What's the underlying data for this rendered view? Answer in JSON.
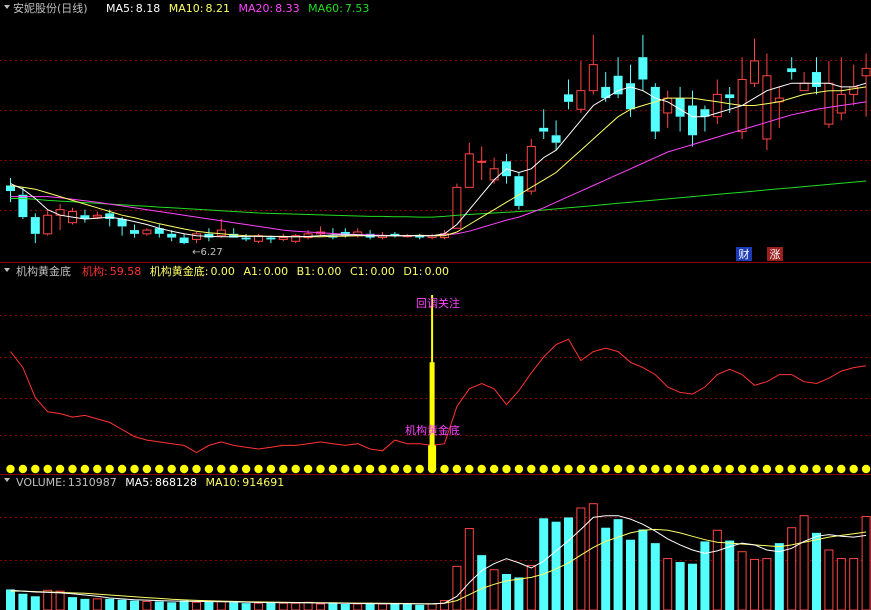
{
  "colors": {
    "bg": "#000000",
    "grid": "#8a0000",
    "up": "#ff4444",
    "down": "#54ffff",
    "ma5": "#ffffff",
    "ma10": "#ffff66",
    "ma20": "#ff44ff",
    "ma60": "#22dd22",
    "label": "#c0c0c0",
    "jigou_line": "#ff3333",
    "signal": "#ffff00",
    "annotation": "#ff44ff"
  },
  "price_panel": {
    "title": "安妮股份(日线)",
    "legend": [
      {
        "label": "MA5:",
        "value": "8.18",
        "color": "#ffffff"
      },
      {
        "label": "MA10:",
        "value": "8.21",
        "color": "#ffff66"
      },
      {
        "label": "MA20:",
        "value": "8.33",
        "color": "#ff44ff"
      },
      {
        "label": "MA60:",
        "value": "7.53",
        "color": "#22dd22"
      }
    ],
    "low_annotation": "←6.27",
    "badges": [
      {
        "text": "财",
        "bg": "#1d3bb5",
        "fg": "#ffffff"
      },
      {
        "text": "涨",
        "bg": "#9a1f1f",
        "fg": "#ffffff"
      }
    ]
  },
  "indicator_panel": {
    "title": "机构黄金底",
    "legend": [
      {
        "label": "机构:",
        "value": "59.58",
        "color": "#ff3333"
      },
      {
        "label": "机构黄金底:",
        "value": "0.00",
        "color": "#ffff66"
      },
      {
        "label": "A1:",
        "value": "0.00",
        "color": "#ffff66"
      },
      {
        "label": "B1:",
        "value": "0.00",
        "color": "#ffff66"
      },
      {
        "label": "C1:",
        "value": "0.00",
        "color": "#ffff66"
      },
      {
        "label": "D1:",
        "value": "0.00",
        "color": "#ffff66"
      }
    ],
    "annotation_top": "回调关注",
    "annotation_bottom": "机构黄金底"
  },
  "volume_panel": {
    "legend": [
      {
        "label": "VOLUME:",
        "value": "1310987",
        "color": "#c0c0c0"
      },
      {
        "label": "MA5:",
        "value": "868128",
        "color": "#ffffff"
      },
      {
        "label": "MA10:",
        "value": "914691",
        "color": "#ffff66"
      }
    ]
  },
  "chart_data": [
    {
      "type": "candlestick",
      "name": "price",
      "ylim": [
        5.9,
        12.3
      ],
      "candles": [
        [
          7.85,
          7.7,
          8.05,
          7.4
        ],
        [
          7.6,
          7.0,
          7.8,
          6.95
        ],
        [
          7.0,
          6.55,
          7.1,
          6.3
        ],
        [
          6.55,
          7.05,
          7.2,
          6.5
        ],
        [
          7.05,
          7.2,
          7.35,
          6.65
        ],
        [
          6.85,
          7.15,
          7.25,
          6.8
        ],
        [
          7.05,
          6.95,
          7.2,
          6.85
        ],
        [
          7.0,
          7.05,
          7.15,
          6.95
        ],
        [
          7.1,
          6.95,
          7.2,
          6.75
        ],
        [
          6.95,
          6.75,
          7.0,
          6.5
        ],
        [
          6.65,
          6.55,
          6.8,
          6.45
        ],
        [
          6.55,
          6.65,
          6.7,
          6.5
        ],
        [
          6.7,
          6.55,
          6.8,
          6.45
        ],
        [
          6.55,
          6.45,
          6.65,
          6.35
        ],
        [
          6.45,
          6.3,
          6.55,
          6.27
        ],
        [
          6.4,
          6.55,
          6.6,
          6.3
        ],
        [
          6.55,
          6.45,
          6.7,
          6.35
        ],
        [
          6.5,
          6.65,
          6.95,
          6.45
        ],
        [
          6.55,
          6.45,
          6.7,
          6.45
        ],
        [
          6.45,
          6.4,
          6.55,
          6.35
        ],
        [
          6.35,
          6.5,
          6.55,
          6.3
        ],
        [
          6.45,
          6.4,
          6.5,
          6.3
        ],
        [
          6.4,
          6.45,
          6.55,
          6.35
        ],
        [
          6.35,
          6.5,
          6.55,
          6.3
        ],
        [
          6.45,
          6.55,
          6.65,
          6.4
        ],
        [
          6.55,
          6.6,
          6.75,
          6.5
        ],
        [
          6.5,
          6.45,
          6.7,
          6.4
        ],
        [
          6.6,
          6.5,
          6.7,
          6.45
        ],
        [
          6.5,
          6.6,
          6.7,
          6.45
        ],
        [
          6.55,
          6.45,
          6.65,
          6.4
        ],
        [
          6.45,
          6.5,
          6.6,
          6.4
        ],
        [
          6.55,
          6.5,
          6.6,
          6.45
        ],
        [
          6.5,
          6.5,
          6.55,
          6.45
        ],
        [
          6.5,
          6.45,
          6.55,
          6.4
        ],
        [
          6.45,
          6.5,
          6.55,
          6.4
        ],
        [
          6.45,
          6.55,
          6.65,
          6.4
        ],
        [
          6.7,
          7.8,
          7.9,
          6.7
        ],
        [
          7.8,
          8.7,
          9.0,
          7.8
        ],
        [
          8.5,
          8.5,
          8.9,
          8.0
        ],
        [
          8.0,
          8.3,
          8.6,
          7.9
        ],
        [
          8.5,
          8.1,
          8.7,
          7.9
        ],
        [
          8.1,
          7.3,
          8.2,
          7.2
        ],
        [
          7.7,
          8.9,
          9.1,
          7.6
        ],
        [
          9.4,
          9.3,
          9.9,
          9.1
        ],
        [
          9.2,
          9.0,
          9.6,
          8.8
        ],
        [
          10.3,
          10.1,
          10.7,
          9.9
        ],
        [
          9.9,
          10.4,
          11.2,
          9.8
        ],
        [
          10.4,
          11.1,
          11.9,
          10.3
        ],
        [
          10.5,
          10.2,
          10.9,
          10.1
        ],
        [
          10.8,
          10.3,
          11.3,
          10.2
        ],
        [
          10.6,
          9.9,
          11.1,
          9.7
        ],
        [
          11.3,
          10.7,
          11.9,
          10.4
        ],
        [
          10.5,
          9.3,
          10.6,
          9.1
        ],
        [
          9.8,
          10.2,
          10.4,
          9.4
        ],
        [
          10.2,
          9.7,
          10.5,
          9.3
        ],
        [
          10.0,
          9.2,
          10.4,
          8.9
        ],
        [
          9.9,
          9.7,
          10.0,
          9.3
        ],
        [
          9.7,
          10.3,
          10.7,
          9.5
        ],
        [
          10.3,
          10.2,
          10.5,
          9.8
        ],
        [
          9.3,
          10.7,
          11.3,
          9.1
        ],
        [
          10.6,
          11.2,
          11.8,
          10.5
        ],
        [
          9.1,
          10.8,
          11.4,
          8.8
        ],
        [
          10.1,
          10.2,
          10.5,
          9.4
        ],
        [
          11.0,
          10.9,
          11.3,
          10.7
        ],
        [
          10.4,
          10.6,
          10.9,
          10.4
        ],
        [
          10.9,
          10.5,
          11.3,
          10.3
        ],
        [
          9.5,
          10.6,
          11.2,
          9.4
        ],
        [
          9.8,
          10.3,
          11.3,
          9.6
        ],
        [
          10.3,
          10.5,
          11.1,
          10.0
        ],
        [
          10.8,
          11.0,
          11.4,
          9.7
        ]
      ],
      "ma5": [
        7.9,
        7.75,
        7.5,
        7.2,
        7.05,
        7.0,
        6.95,
        6.97,
        7.0,
        6.95,
        6.88,
        6.8,
        6.7,
        6.62,
        6.55,
        6.5,
        6.48,
        6.47,
        6.47,
        6.48,
        6.48,
        6.48,
        6.47,
        6.47,
        6.48,
        6.5,
        6.52,
        6.52,
        6.52,
        6.5,
        6.5,
        6.5,
        6.5,
        6.5,
        6.5,
        6.55,
        6.8,
        7.2,
        7.6,
        8.0,
        8.3,
        8.2,
        8.3,
        8.6,
        8.8,
        9.2,
        9.6,
        10.0,
        10.2,
        10.4,
        10.5,
        10.4,
        10.2,
        10.1,
        9.9,
        9.7,
        9.7,
        9.8,
        9.9,
        10.0,
        10.2,
        10.4,
        10.5,
        10.6,
        10.6,
        10.6,
        10.6,
        10.5,
        10.5,
        10.6
      ],
      "ma10": [
        7.85,
        7.8,
        7.75,
        7.65,
        7.55,
        7.45,
        7.35,
        7.25,
        7.15,
        7.05,
        6.98,
        6.9,
        6.82,
        6.75,
        6.68,
        6.62,
        6.58,
        6.55,
        6.52,
        6.5,
        6.49,
        6.48,
        6.48,
        6.47,
        6.47,
        6.47,
        6.48,
        6.49,
        6.5,
        6.5,
        6.5,
        6.5,
        6.5,
        6.51,
        6.5,
        6.5,
        6.6,
        6.8,
        7.0,
        7.2,
        7.4,
        7.6,
        7.8,
        8.0,
        8.2,
        8.5,
        8.8,
        9.1,
        9.4,
        9.7,
        9.9,
        10.0,
        10.1,
        10.2,
        10.2,
        10.2,
        10.15,
        10.1,
        10.05,
        10.0,
        10.0,
        10.05,
        10.1,
        10.2,
        10.3,
        10.35,
        10.4,
        10.4,
        10.45,
        10.5
      ],
      "ma20": [
        7.55,
        7.55,
        7.55,
        7.55,
        7.52,
        7.48,
        7.44,
        7.4,
        7.35,
        7.3,
        7.25,
        7.2,
        7.15,
        7.1,
        7.05,
        7.0,
        6.95,
        6.9,
        6.85,
        6.8,
        6.75,
        6.7,
        6.65,
        6.62,
        6.6,
        6.58,
        6.56,
        6.54,
        6.53,
        6.52,
        6.51,
        6.5,
        6.5,
        6.5,
        6.5,
        6.52,
        6.55,
        6.62,
        6.72,
        6.82,
        6.92,
        7.0,
        7.12,
        7.25,
        7.4,
        7.55,
        7.7,
        7.85,
        8.0,
        8.15,
        8.3,
        8.45,
        8.6,
        8.75,
        8.85,
        8.95,
        9.05,
        9.15,
        9.25,
        9.35,
        9.45,
        9.55,
        9.65,
        9.75,
        9.82,
        9.9,
        9.95,
        10.0,
        10.05,
        10.1
      ],
      "ma60": [
        7.5,
        7.5,
        7.48,
        7.45,
        7.43,
        7.41,
        7.39,
        7.37,
        7.35,
        7.33,
        7.31,
        7.29,
        7.27,
        7.25,
        7.23,
        7.21,
        7.19,
        7.17,
        7.15,
        7.13,
        7.11,
        7.1,
        7.09,
        7.08,
        7.07,
        7.06,
        7.05,
        7.04,
        7.03,
        7.02,
        7.02,
        7.01,
        7.01,
        7.0,
        7.0,
        7.02,
        7.05,
        7.07,
        7.09,
        7.11,
        7.13,
        7.15,
        7.17,
        7.19,
        7.22,
        7.25,
        7.28,
        7.31,
        7.34,
        7.37,
        7.4,
        7.43,
        7.46,
        7.49,
        7.52,
        7.55,
        7.58,
        7.61,
        7.64,
        7.67,
        7.7,
        7.73,
        7.76,
        7.79,
        7.82,
        7.85,
        7.88,
        7.91,
        7.94,
        7.97
      ],
      "low_marker": {
        "index": 14,
        "value": 6.27
      }
    },
    {
      "type": "line",
      "name": "机构",
      "ylim": [
        0,
        100
      ],
      "values": [
        68,
        59,
        42,
        34,
        33,
        31,
        32,
        30,
        28,
        24,
        20,
        18,
        17,
        16,
        15,
        11,
        15,
        17,
        15,
        14,
        13,
        14,
        15,
        15,
        16,
        17,
        16,
        15,
        16,
        13,
        12,
        18,
        16,
        16,
        15,
        16,
        37,
        47,
        50,
        47,
        38,
        46,
        56,
        65,
        72,
        75,
        63,
        68,
        70,
        68,
        62,
        59,
        55,
        48,
        45,
        44,
        48,
        55,
        58,
        55,
        49,
        51,
        55,
        55,
        51,
        50,
        53,
        57,
        59,
        60
      ],
      "signal": {
        "index": 34,
        "value": 100
      },
      "base_dots": 70
    },
    {
      "type": "bar",
      "name": "VOLUME",
      "ylim": [
        0,
        1400000
      ],
      "values": [
        240000,
        190000,
        160000,
        230000,
        220000,
        150000,
        130000,
        130000,
        130000,
        120000,
        110000,
        100000,
        100000,
        90000,
        110000,
        90000,
        100000,
        100000,
        90000,
        80000,
        80000,
        90000,
        80000,
        80000,
        90000,
        70000,
        80000,
        70000,
        70000,
        80000,
        70000,
        70000,
        70000,
        60000,
        70000,
        110000,
        510000,
        950000,
        640000,
        470000,
        420000,
        380000,
        520000,
        1070000,
        1030000,
        1080000,
        1190000,
        1240000,
        960000,
        1060000,
        820000,
        940000,
        780000,
        600000,
        560000,
        540000,
        800000,
        930000,
        810000,
        680000,
        590000,
        600000,
        780000,
        960000,
        1100000,
        900000,
        700000,
        600000,
        600000,
        1090000
      ],
      "up": [
        false,
        false,
        false,
        true,
        true,
        false,
        false,
        true,
        false,
        false,
        false,
        true,
        false,
        false,
        false,
        true,
        false,
        true,
        false,
        false,
        true,
        false,
        true,
        true,
        true,
        true,
        false,
        false,
        true,
        false,
        true,
        false,
        false,
        false,
        true,
        true,
        true,
        true,
        false,
        true,
        false,
        false,
        true,
        false,
        false,
        false,
        true,
        true,
        false,
        false,
        false,
        false,
        false,
        true,
        false,
        false,
        false,
        true,
        false,
        true,
        true,
        true,
        false,
        true,
        true,
        false,
        true,
        true,
        true,
        true
      ],
      "ma5": [
        230000,
        220000,
        210000,
        205000,
        200000,
        190000,
        175000,
        160000,
        140000,
        130000,
        120000,
        115000,
        110000,
        105000,
        103000,
        100000,
        98000,
        97000,
        95000,
        92000,
        88000,
        86000,
        85000,
        84000,
        83000,
        82000,
        80000,
        78000,
        76000,
        75000,
        74000,
        73000,
        72000,
        71000,
        70000,
        80000,
        160000,
        320000,
        460000,
        540000,
        600000,
        550000,
        490000,
        570000,
        690000,
        810000,
        940000,
        1080000,
        1100000,
        1100000,
        1060000,
        1000000,
        920000,
        830000,
        760000,
        700000,
        660000,
        690000,
        740000,
        780000,
        760000,
        700000,
        680000,
        720000,
        800000,
        860000,
        880000,
        860000,
        850000,
        870000
      ],
      "ma10": [
        220000,
        220000,
        215000,
        210000,
        205000,
        200000,
        195000,
        185000,
        175000,
        165000,
        155000,
        145000,
        135000,
        125000,
        118000,
        112000,
        108000,
        104000,
        100000,
        97000,
        94000,
        92000,
        90000,
        88000,
        87000,
        85000,
        84000,
        82000,
        81000,
        80000,
        78000,
        77000,
        76000,
        74000,
        73000,
        78000,
        110000,
        180000,
        250000,
        300000,
        340000,
        360000,
        380000,
        420000,
        480000,
        550000,
        640000,
        730000,
        800000,
        850000,
        900000,
        930000,
        940000,
        930000,
        900000,
        860000,
        820000,
        790000,
        780000,
        770000,
        760000,
        750000,
        740000,
        760000,
        790000,
        820000,
        850000,
        870000,
        890000,
        910000
      ]
    }
  ]
}
